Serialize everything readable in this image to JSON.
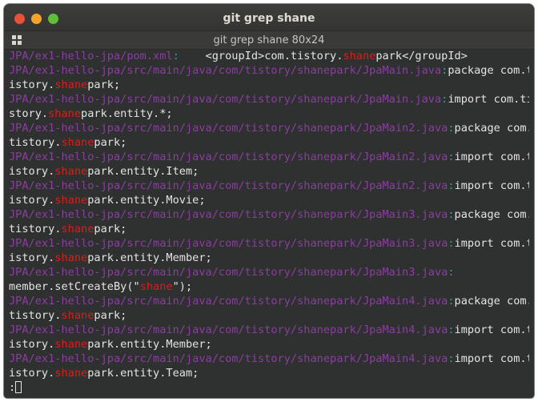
{
  "window": {
    "title": "git grep shane"
  },
  "tab": {
    "title": "git grep shane 80x24",
    "icon": "grid-menu-icon"
  },
  "terminal": {
    "rows": [
      [
        {
          "t": "fn",
          "v": "JPA/ex1-hello-jpa/pom.xml"
        },
        {
          "t": "sep",
          "v": ":"
        },
        {
          "t": "txt",
          "v": "    <groupId>com.tistory."
        },
        {
          "t": "hl",
          "v": "shane"
        },
        {
          "t": "txt",
          "v": "park</groupId>"
        }
      ],
      [
        {
          "t": "fn",
          "v": "JPA/ex1-hello-jpa/src/main/java/com/tistory/shanepark/JpaMain.java"
        },
        {
          "t": "sep",
          "v": ":"
        },
        {
          "t": "txt",
          "v": "package com.t"
        }
      ],
      [
        {
          "t": "txt",
          "v": "istory."
        },
        {
          "t": "hl",
          "v": "shane"
        },
        {
          "t": "txt",
          "v": "park;"
        }
      ],
      [
        {
          "t": "fn",
          "v": "JPA/ex1-hello-jpa/src/main/java/com/tistory/shanepark/JpaMain.java"
        },
        {
          "t": "sep",
          "v": ":"
        },
        {
          "t": "txt",
          "v": "import com.ti"
        }
      ],
      [
        {
          "t": "txt",
          "v": "story."
        },
        {
          "t": "hl",
          "v": "shane"
        },
        {
          "t": "txt",
          "v": "park.entity.*;"
        }
      ],
      [
        {
          "t": "fn",
          "v": "JPA/ex1-hello-jpa/src/main/java/com/tistory/shanepark/JpaMain2.java"
        },
        {
          "t": "sep",
          "v": ":"
        },
        {
          "t": "txt",
          "v": "package com."
        }
      ],
      [
        {
          "t": "txt",
          "v": "tistory."
        },
        {
          "t": "hl",
          "v": "shane"
        },
        {
          "t": "txt",
          "v": "park;"
        }
      ],
      [
        {
          "t": "fn",
          "v": "JPA/ex1-hello-jpa/src/main/java/com/tistory/shanepark/JpaMain2.java"
        },
        {
          "t": "sep",
          "v": ":"
        },
        {
          "t": "txt",
          "v": "import com.t"
        }
      ],
      [
        {
          "t": "txt",
          "v": "istory."
        },
        {
          "t": "hl",
          "v": "shane"
        },
        {
          "t": "txt",
          "v": "park.entity.Item;"
        }
      ],
      [
        {
          "t": "fn",
          "v": "JPA/ex1-hello-jpa/src/main/java/com/tistory/shanepark/JpaMain2.java"
        },
        {
          "t": "sep",
          "v": ":"
        },
        {
          "t": "txt",
          "v": "import com.t"
        }
      ],
      [
        {
          "t": "txt",
          "v": "istory."
        },
        {
          "t": "hl",
          "v": "shane"
        },
        {
          "t": "txt",
          "v": "park.entity.Movie;"
        }
      ],
      [
        {
          "t": "fn",
          "v": "JPA/ex1-hello-jpa/src/main/java/com/tistory/shanepark/JpaMain3.java"
        },
        {
          "t": "sep",
          "v": ":"
        },
        {
          "t": "txt",
          "v": "package com."
        }
      ],
      [
        {
          "t": "txt",
          "v": "tistory."
        },
        {
          "t": "hl",
          "v": "shane"
        },
        {
          "t": "txt",
          "v": "park;"
        }
      ],
      [
        {
          "t": "fn",
          "v": "JPA/ex1-hello-jpa/src/main/java/com/tistory/shanepark/JpaMain3.java"
        },
        {
          "t": "sep",
          "v": ":"
        },
        {
          "t": "txt",
          "v": "import com.t"
        }
      ],
      [
        {
          "t": "txt",
          "v": "istory."
        },
        {
          "t": "hl",
          "v": "shane"
        },
        {
          "t": "txt",
          "v": "park.entity.Member;"
        }
      ],
      [
        {
          "t": "fn",
          "v": "JPA/ex1-hello-jpa/src/main/java/com/tistory/shanepark/JpaMain3.java"
        },
        {
          "t": "sep",
          "v": ":"
        }
      ],
      [
        {
          "t": "txt",
          "v": "member.setCreateBy(\""
        },
        {
          "t": "hl",
          "v": "shane"
        },
        {
          "t": "txt",
          "v": "\");"
        }
      ],
      [
        {
          "t": "fn",
          "v": "JPA/ex1-hello-jpa/src/main/java/com/tistory/shanepark/JpaMain4.java"
        },
        {
          "t": "sep",
          "v": ":"
        },
        {
          "t": "txt",
          "v": "package com."
        }
      ],
      [
        {
          "t": "txt",
          "v": "tistory."
        },
        {
          "t": "hl",
          "v": "shane"
        },
        {
          "t": "txt",
          "v": "park;"
        }
      ],
      [
        {
          "t": "fn",
          "v": "JPA/ex1-hello-jpa/src/main/java/com/tistory/shanepark/JpaMain4.java"
        },
        {
          "t": "sep",
          "v": ":"
        },
        {
          "t": "txt",
          "v": "import com.t"
        }
      ],
      [
        {
          "t": "txt",
          "v": "istory."
        },
        {
          "t": "hl",
          "v": "shane"
        },
        {
          "t": "txt",
          "v": "park.entity.Member;"
        }
      ],
      [
        {
          "t": "fn",
          "v": "JPA/ex1-hello-jpa/src/main/java/com/tistory/shanepark/JpaMain4.java"
        },
        {
          "t": "sep",
          "v": ":"
        },
        {
          "t": "txt",
          "v": "import com.t"
        }
      ],
      [
        {
          "t": "txt",
          "v": "istory."
        },
        {
          "t": "hl",
          "v": "shane"
        },
        {
          "t": "txt",
          "v": "park.entity.Team;"
        }
      ]
    ],
    "prompt": ":",
    "colors": {
      "filename": "#8a3ea0",
      "separator": "#1fa6a6",
      "match": "#d5211c",
      "text": "#e4e4e2",
      "background": "#2f3030"
    }
  }
}
